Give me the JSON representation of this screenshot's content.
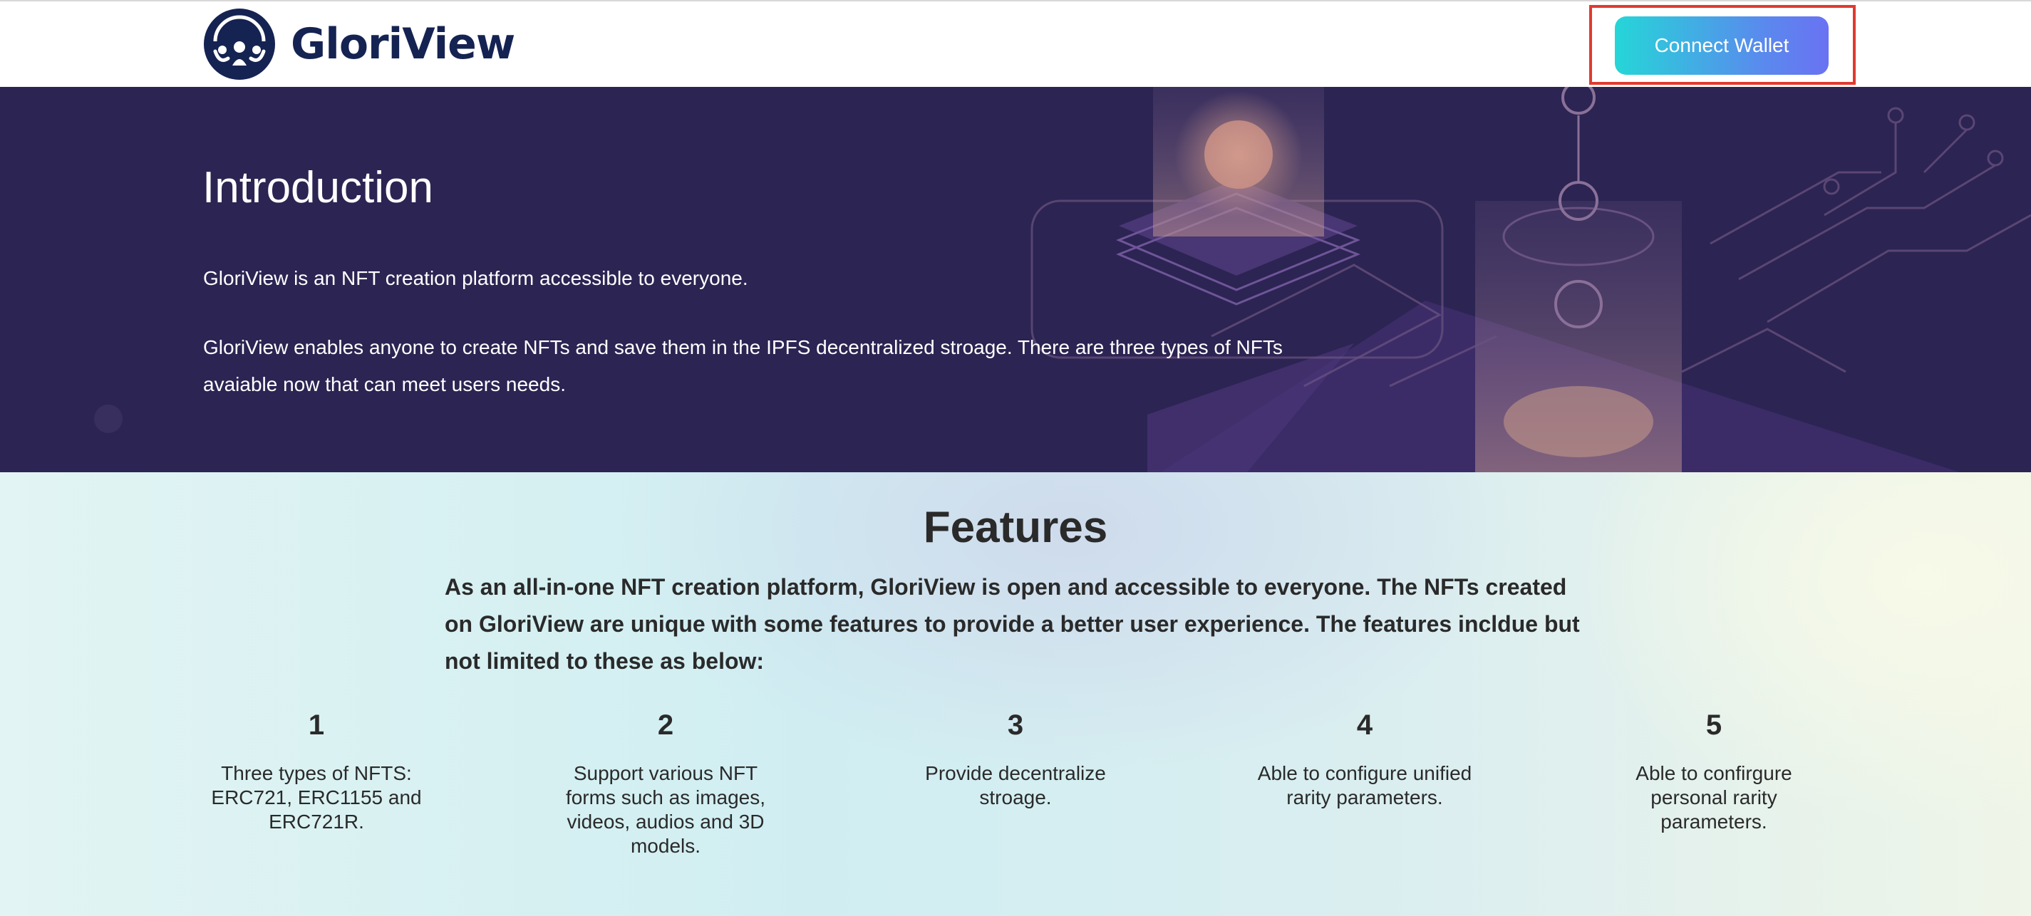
{
  "header": {
    "brand": "GloriView",
    "logo_icon": "people-circle-logo-icon",
    "connect_wallet_label": "Connect Wallet"
  },
  "hero": {
    "title": "Introduction",
    "paragraph_1": "GloriView is an NFT creation platform accessible to everyone.",
    "paragraph_2": "GloriView enables anyone to create NFTs and save them in the IPFS decentralized stroage. There are three types of NFTs avaiable now that can meet users needs."
  },
  "features": {
    "title": "Features",
    "intro": "As an all-in-one NFT creation platform, GloriView is open and accessible to everyone. The NFTs created on GloriView are unique with some features to provide a better user experience. The features incldue but not limited to these as below:",
    "items": [
      {
        "number": "1",
        "text": "Three types of NFTS: ERC721, ERC1155 and ERC721R."
      },
      {
        "number": "2",
        "text": "Support various NFT forms such as images, videos, audios and 3D models."
      },
      {
        "number": "3",
        "text": "Provide decentralize stroage."
      },
      {
        "number": "4",
        "text": "Able to configure unified rarity parameters."
      },
      {
        "number": "5",
        "text": "Able to confirgure personal rarity parameters."
      }
    ]
  },
  "colors": {
    "brand_navy": "#152352",
    "hero_bg": "#2c2452",
    "button_gradient_start": "#25d6d8",
    "button_gradient_end": "#6a72f2",
    "highlight_frame": "#e03a2f"
  }
}
